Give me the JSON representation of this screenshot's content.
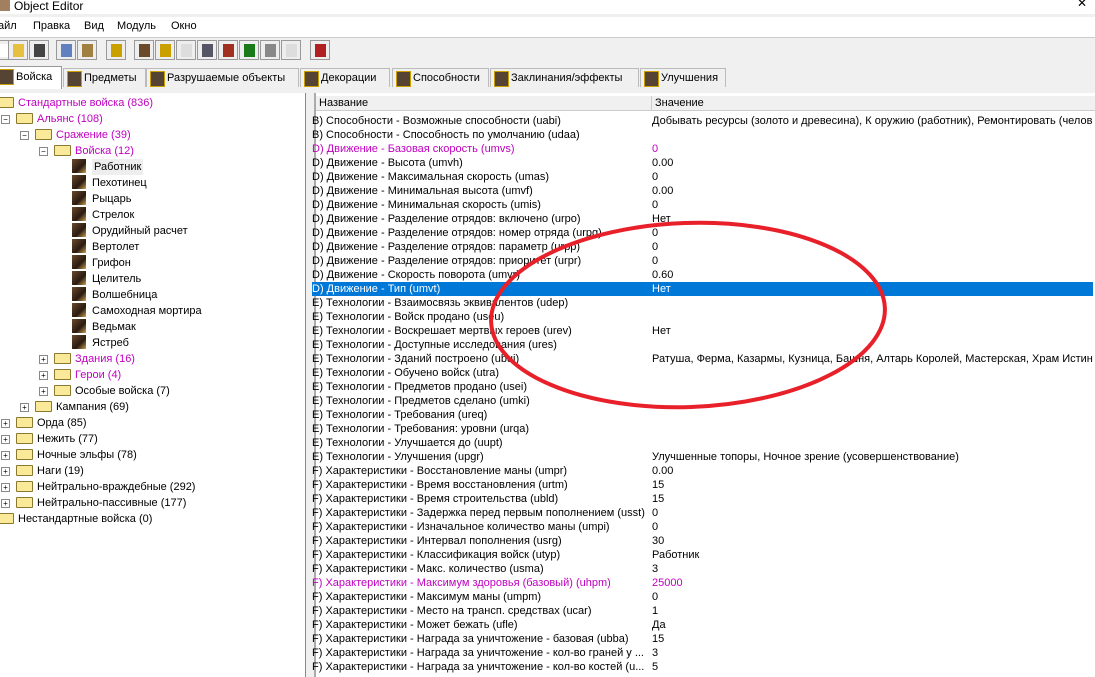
{
  "window": {
    "title": "Object Editor",
    "close": "✕"
  },
  "menu": [
    "айл",
    "Правка",
    "Вид",
    "Модуль",
    "Окно"
  ],
  "toolbar": [
    "new-icon",
    "open-icon",
    "save-icon",
    "copy-icon",
    "paste-icon",
    "unit-icon",
    "terrain-icon",
    "text-icon",
    "sound-icon",
    "unit-active-icon",
    "item-icon",
    "tiki-icon",
    "rock-icon",
    "import-icon",
    "check-icon"
  ],
  "tabs": [
    "Войска",
    "Предметы",
    "Разрушаемые объекты",
    "Декорации",
    "Способности",
    "Заклинания/эффекты",
    "Улучшения"
  ],
  "columns": {
    "name": "Название",
    "value": "Значение"
  },
  "colors": {
    "modified": "#c000c0",
    "selected": "#0078d7",
    "annotation": "#e8202a"
  },
  "tree": [
    {
      "label": "Стандартные войска (836)",
      "level": 0,
      "type": "folder",
      "exp": "",
      "mod": true
    },
    {
      "label": "Альянс (108)",
      "level": 1,
      "type": "folder",
      "exp": "−",
      "mod": true
    },
    {
      "label": "Сражение (39)",
      "level": 2,
      "type": "folder",
      "exp": "−",
      "mod": true
    },
    {
      "label": "Войска (12)",
      "level": 3,
      "type": "folder",
      "exp": "−",
      "mod": true
    },
    {
      "label": "Работник",
      "level": 4,
      "type": "unit",
      "exp": "",
      "sel": true
    },
    {
      "label": "Пехотинец",
      "level": 4,
      "type": "unit",
      "exp": ""
    },
    {
      "label": "Рыцарь",
      "level": 4,
      "type": "unit",
      "exp": ""
    },
    {
      "label": "Стрелок",
      "level": 4,
      "type": "unit",
      "exp": ""
    },
    {
      "label": "Орудийный расчет",
      "level": 4,
      "type": "unit",
      "exp": ""
    },
    {
      "label": "Вертолет",
      "level": 4,
      "type": "unit",
      "exp": ""
    },
    {
      "label": "Грифон",
      "level": 4,
      "type": "unit",
      "exp": ""
    },
    {
      "label": "Целитель",
      "level": 4,
      "type": "unit",
      "exp": ""
    },
    {
      "label": "Волшебница",
      "level": 4,
      "type": "unit",
      "exp": ""
    },
    {
      "label": "Самоходная мортира",
      "level": 4,
      "type": "unit",
      "exp": ""
    },
    {
      "label": "Ведьмак",
      "level": 4,
      "type": "unit",
      "exp": ""
    },
    {
      "label": "Ястреб",
      "level": 4,
      "type": "unit",
      "exp": ""
    },
    {
      "label": "Здания (16)",
      "level": 3,
      "type": "folder",
      "exp": "+",
      "mod": true
    },
    {
      "label": "Герои (4)",
      "level": 3,
      "type": "folder",
      "exp": "+",
      "mod": true
    },
    {
      "label": "Особые войска (7)",
      "level": 3,
      "type": "folder",
      "exp": "+"
    },
    {
      "label": "Кампания (69)",
      "level": 2,
      "type": "folder",
      "exp": "+"
    },
    {
      "label": "Орда (85)",
      "level": 1,
      "type": "folder",
      "exp": "+"
    },
    {
      "label": "Нежить (77)",
      "level": 1,
      "type": "folder",
      "exp": "+"
    },
    {
      "label": "Ночные эльфы (78)",
      "level": 1,
      "type": "folder",
      "exp": "+"
    },
    {
      "label": "Наги (19)",
      "level": 1,
      "type": "folder",
      "exp": "+"
    },
    {
      "label": "Нейтрально-враждебные (292)",
      "level": 1,
      "type": "folder",
      "exp": "+"
    },
    {
      "label": "Нейтрально-пассивные (177)",
      "level": 1,
      "type": "folder",
      "exp": "+"
    },
    {
      "label": "Нестандартные войска (0)",
      "level": 0,
      "type": "folder",
      "exp": ""
    }
  ],
  "rows": [
    {
      "name": "B) Способности - Возможные способности (uabi)",
      "value": "Добывать ресурсы (золото и древесина), К оружию (работник), Ремонтировать (челов"
    },
    {
      "name": "B) Способности - Способность по умолчанию (udaa)",
      "value": ""
    },
    {
      "name": "D) Движение - Базовая скорость (umvs)",
      "value": "0",
      "mod": true
    },
    {
      "name": "D) Движение - Высота (umvh)",
      "value": "0.00"
    },
    {
      "name": "D) Движение - Максимальная скорость (umas)",
      "value": "0"
    },
    {
      "name": "D) Движение - Минимальная высота (umvf)",
      "value": "0.00"
    },
    {
      "name": "D) Движение - Минимальная скорость (umis)",
      "value": "0"
    },
    {
      "name": "D) Движение - Разделение отрядов: включено (urpo)",
      "value": "Нет"
    },
    {
      "name": "D) Движение - Разделение отрядов: номер отряда (urpg)",
      "value": "0"
    },
    {
      "name": "D) Движение - Разделение отрядов: параметр (urpp)",
      "value": "0"
    },
    {
      "name": "D) Движение - Разделение отрядов: приоритет (urpr)",
      "value": "0"
    },
    {
      "name": "D) Движение - Скорость поворота (umvr)",
      "value": "0.60"
    },
    {
      "name": "D) Движение - Тип (umvt)",
      "value": "Нет",
      "sel": true
    },
    {
      "name": "E) Технологии - Взаимосвязь эквивалентов (udep)",
      "value": ""
    },
    {
      "name": "E) Технологии - Войск продано (useu)",
      "value": ""
    },
    {
      "name": "E) Технологии - Воскрешает мертвых героев (urev)",
      "value": "Нет"
    },
    {
      "name": "E) Технологии - Доступные исследования (ures)",
      "value": ""
    },
    {
      "name": "E) Технологии - Зданий построено (ubui)",
      "value": "Ратуша, Ферма, Казармы, Кузница, Башня, Алтарь Королей, Мастерская, Храм Истин"
    },
    {
      "name": "E) Технологии - Обучено войск (utra)",
      "value": ""
    },
    {
      "name": "E) Технологии - Предметов продано (usei)",
      "value": ""
    },
    {
      "name": "E) Технологии - Предметов сделано (umki)",
      "value": ""
    },
    {
      "name": "E) Технологии - Требования (ureq)",
      "value": ""
    },
    {
      "name": "E) Технологии - Требования: уровни (urqa)",
      "value": ""
    },
    {
      "name": "E) Технологии - Улучшается до (uupt)",
      "value": ""
    },
    {
      "name": "E) Технологии - Улучшения (upgr)",
      "value": "Улучшенные топоры, Ночное зрение (усовершенствование)"
    },
    {
      "name": "F) Характеристики - Восстановление маны (umpr)",
      "value": "0.00"
    },
    {
      "name": "F) Характеристики - Время восстановления (urtm)",
      "value": "15"
    },
    {
      "name": "F) Характеристики - Время строительства (ubld)",
      "value": "15"
    },
    {
      "name": "F) Характеристики - Задержка перед первым пополнением (usst)",
      "value": "0"
    },
    {
      "name": "F) Характеристики - Изначальное количество маны (umpi)",
      "value": "0"
    },
    {
      "name": "F) Характеристики - Интервал пополнения (usrg)",
      "value": "30"
    },
    {
      "name": "F) Характеристики - Классификация войск (utyp)",
      "value": "Работник"
    },
    {
      "name": "F) Характеристики - Макс. количество (usma)",
      "value": "3"
    },
    {
      "name": "F) Характеристики - Максимум здоровья (базовый) (uhpm)",
      "value": "25000",
      "mod": true
    },
    {
      "name": "F) Характеристики - Максимум маны (umpm)",
      "value": "0"
    },
    {
      "name": "F) Характеристики - Место на трансп. средствах (ucar)",
      "value": "1"
    },
    {
      "name": "F) Характеристики - Может бежать (ufle)",
      "value": "Да"
    },
    {
      "name": "F) Характеристики - Награда за уничтожение - базовая (ubba)",
      "value": "15"
    },
    {
      "name": "F) Характеристики - Награда за уничтожение - кол-во граней у ...",
      "value": "3"
    },
    {
      "name": "F) Характеристики - Награда за уничтожение - кол-во костей (u...",
      "value": "5"
    }
  ]
}
